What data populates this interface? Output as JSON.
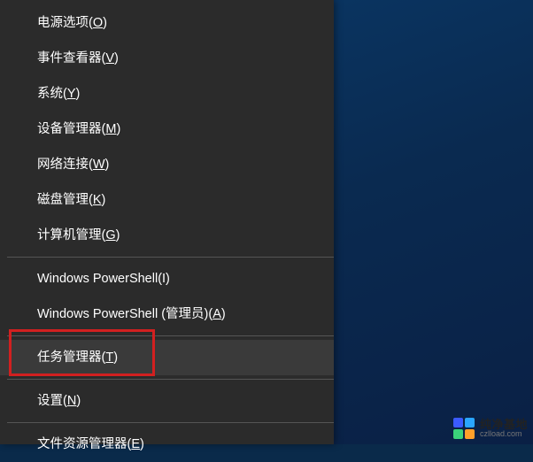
{
  "menu": {
    "items": [
      {
        "text": "电源选项(",
        "hotkey": "O",
        "after": ")",
        "highlighted": false
      },
      {
        "text": "事件查看器(",
        "hotkey": "V",
        "after": ")",
        "highlighted": false
      },
      {
        "text": "系统(",
        "hotkey": "Y",
        "after": ")",
        "highlighted": false
      },
      {
        "text": "设备管理器(",
        "hotkey": "M",
        "after": ")",
        "highlighted": false
      },
      {
        "text": "网络连接(",
        "hotkey": "W",
        "after": ")",
        "highlighted": false
      },
      {
        "text": "磁盘管理(",
        "hotkey": "K",
        "after": ")",
        "highlighted": false
      },
      {
        "text": "计算机管理(",
        "hotkey": "G",
        "after": ")",
        "highlighted": false
      },
      {
        "divider": true
      },
      {
        "text": "Windows PowerShell(I)",
        "hotkey": "",
        "after": "",
        "highlighted": false
      },
      {
        "text": "Windows PowerShell (管理员)(",
        "hotkey": "A",
        "after": ")",
        "highlighted": false
      },
      {
        "divider": true
      },
      {
        "text": "任务管理器(",
        "hotkey": "T",
        "after": ")",
        "highlighted": true
      },
      {
        "divider": true
      },
      {
        "text": "设置(",
        "hotkey": "N",
        "after": ")",
        "highlighted": false
      },
      {
        "divider": true
      },
      {
        "text": "文件资源管理器(",
        "hotkey": "E",
        "after": ")",
        "highlighted": false
      }
    ]
  },
  "watermark": {
    "title": "纯净基地",
    "sub": "czlload.com"
  },
  "colors": {
    "menu_bg": "#2b2b2b",
    "menu_highlight": "#3a3a3a",
    "red_box": "#d22020",
    "desk1": "#0a3a6a",
    "desk2": "#0a2045",
    "logo_blue": "#3b5bff",
    "logo_cyan": "#2aa6ff",
    "logo_green": "#3bd27a",
    "logo_orange": "#ffa02a"
  }
}
